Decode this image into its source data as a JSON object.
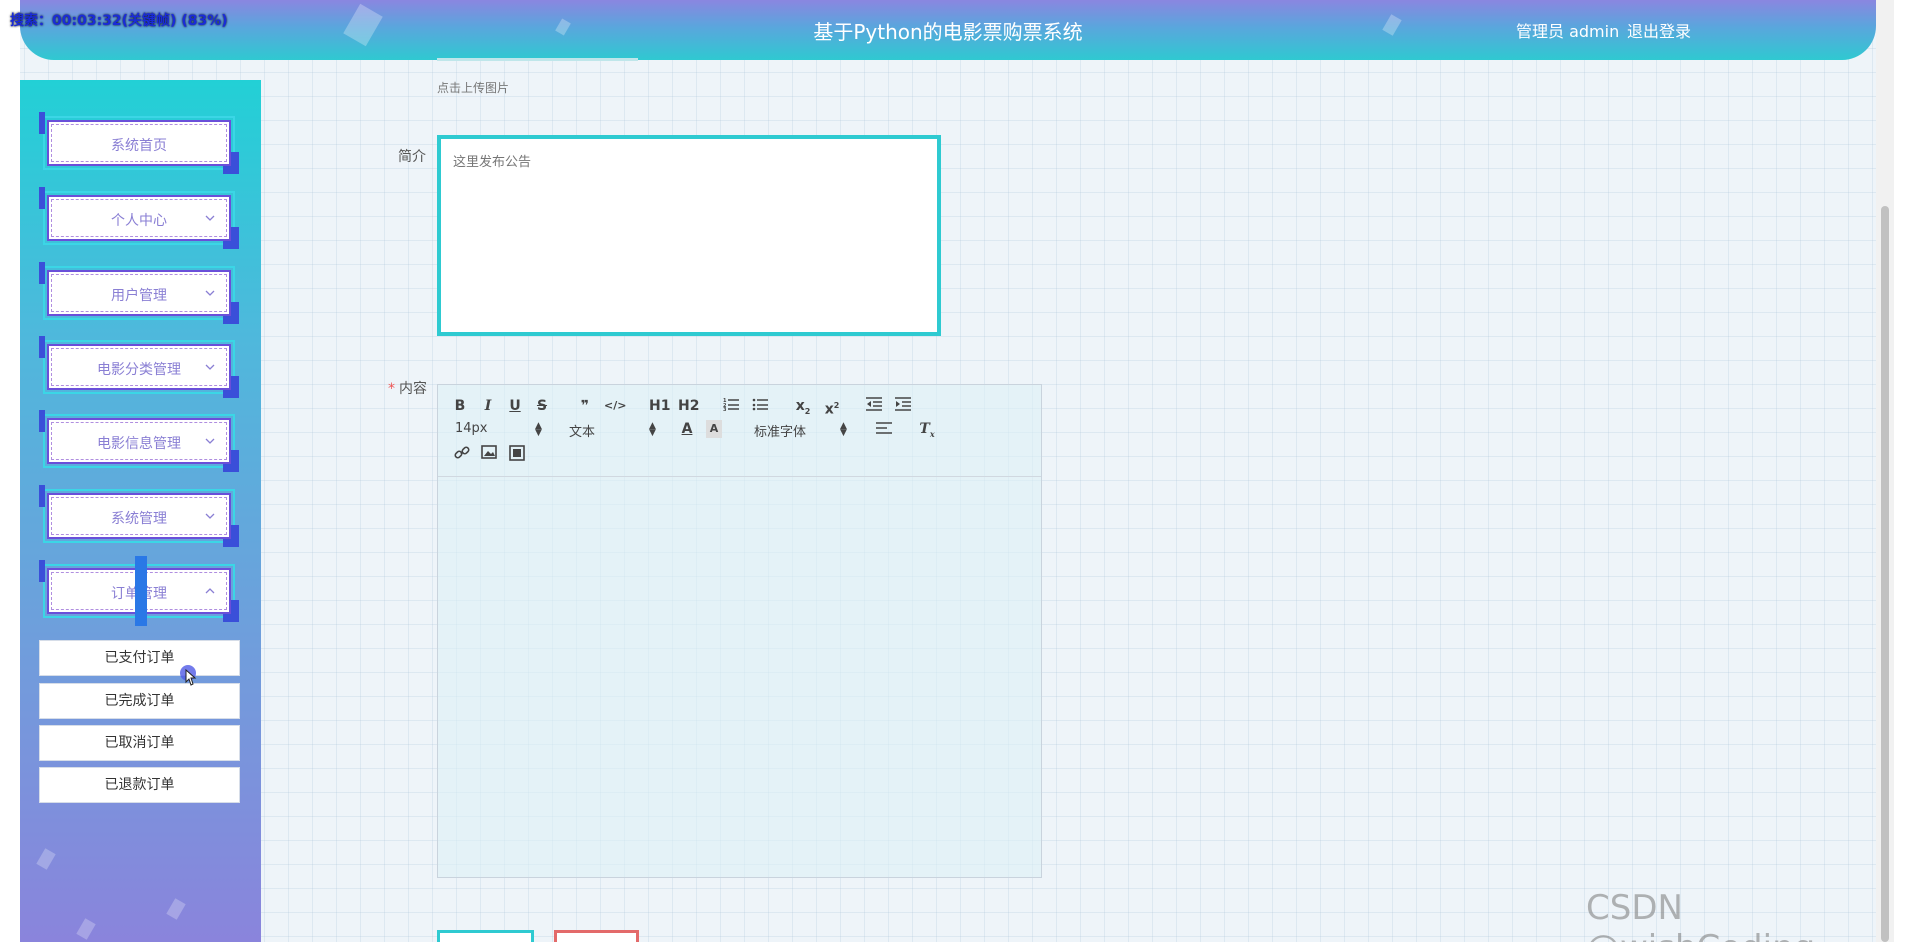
{
  "header": {
    "title": "基于Python的电影票购票系统",
    "user": "管理员 admin",
    "logout": "退出登录"
  },
  "recorder": "搜索：00:03:32(关键帧) (83%)",
  "sidebar": {
    "items": [
      {
        "label": "系统首页"
      },
      {
        "label": "个人中心"
      },
      {
        "label": "用户管理"
      },
      {
        "label": "电影分类管理"
      },
      {
        "label": "电影信息管理"
      },
      {
        "label": "系统管理"
      },
      {
        "label": "订单管理"
      }
    ],
    "subitems": [
      {
        "label": "已支付订单"
      },
      {
        "label": "已完成订单"
      },
      {
        "label": "已取消订单"
      },
      {
        "label": "已退款订单"
      }
    ]
  },
  "form": {
    "upload_hint": "点击上传图片",
    "intro_label": "简介",
    "intro_placeholder": "这里发布公告",
    "content_required": "*",
    "content_label": "内容"
  },
  "editor": {
    "font_size": "14px",
    "heading": "文本",
    "font_family": "标准字体",
    "h1": "H1",
    "h2": "H2"
  },
  "watermark": "CSDN @wishCoding",
  "colors": {
    "accent": "#2ecad1",
    "menu_border": "#6a4fd9",
    "cancel": "#e36a6a"
  }
}
